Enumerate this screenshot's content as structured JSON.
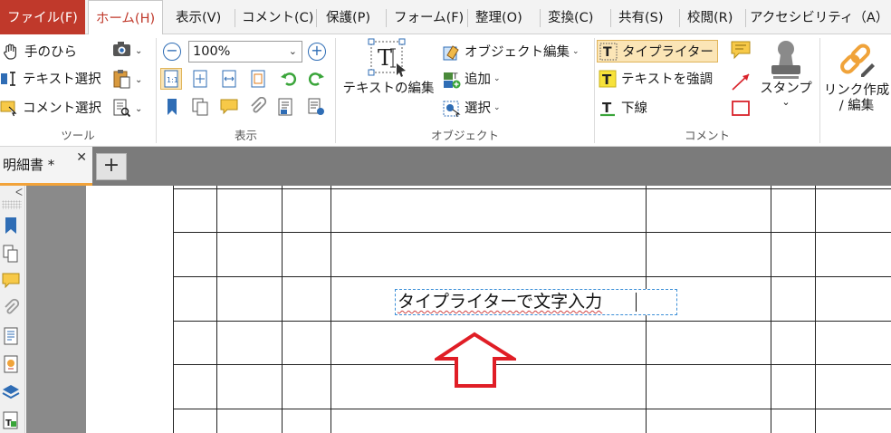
{
  "menu": {
    "items": [
      {
        "label": "ファイル(F)"
      },
      {
        "label": "ホーム(H)"
      },
      {
        "label": "表示(V)"
      },
      {
        "label": "コメント(C)"
      },
      {
        "label": "保護(P)"
      },
      {
        "label": "フォーム(F)"
      },
      {
        "label": "整理(O)"
      },
      {
        "label": "変換(C)"
      },
      {
        "label": "共有(S)"
      },
      {
        "label": "校閲(R)"
      },
      {
        "label": "アクセシビリティ（A）"
      }
    ]
  },
  "ribbon": {
    "tools": {
      "hand": "手のひら",
      "text_select": "テキスト選択",
      "comment_select": "コメント選択",
      "label": "ツール"
    },
    "view": {
      "zoom": "100%",
      "label": "表示"
    },
    "object": {
      "edit_text": "テキストの編集",
      "edit_object": "オブジェクト編集",
      "add": "追加",
      "select": "選択",
      "label": "オブジェクト"
    },
    "comment": {
      "typewriter": "タイプライター",
      "highlight": "テキストを強調",
      "underline": "下線",
      "stamp": "スタンプ",
      "label": "コメント"
    },
    "link": {
      "line1": "リンク作成",
      "line2": "/ 編集"
    }
  },
  "tabs": {
    "doc_tab": "明細書 *",
    "close": "✕",
    "new_tab": "+"
  },
  "document": {
    "typewriter_text": "タイプライターで文字入力"
  },
  "colors": {
    "accent": "#c0392b",
    "active_tab_underline": "#f2a33a",
    "selection_border": "#3b8fd8",
    "arrow": "#e01e26"
  }
}
